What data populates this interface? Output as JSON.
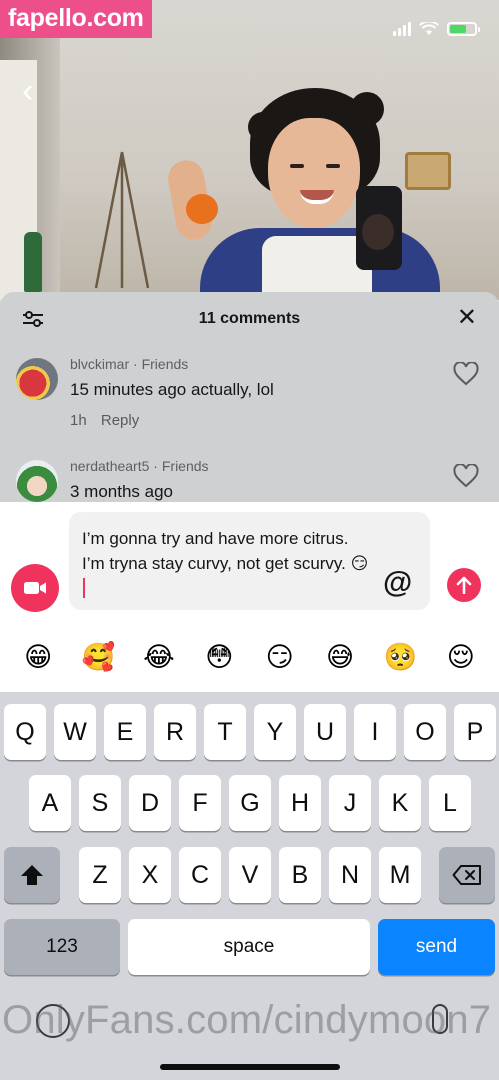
{
  "watermark": {
    "site": "fapello.com",
    "bottom": "OnlyFans.com/cindymoon7"
  },
  "comments_panel": {
    "title": "11 comments",
    "comments": [
      {
        "username": "blvckimar",
        "badge": "Friends",
        "text": "15 minutes ago actually, lol",
        "age": "1h",
        "reply_label": "Reply"
      },
      {
        "username": "nerdatheart5",
        "badge": "Friends",
        "text": "3 months ago"
      }
    ]
  },
  "composer": {
    "draft_text": "I’m gonna try and have more citrus. I’m tryna stay curvy, not get scurvy. 😏",
    "mention_symbol": "@",
    "emojis": [
      "😁",
      "🥰",
      "😂",
      "😳",
      "😏",
      "😅",
      "🥺",
      "😌"
    ]
  },
  "keyboard": {
    "row1": [
      "Q",
      "W",
      "E",
      "R",
      "T",
      "Y",
      "U",
      "I",
      "O",
      "P"
    ],
    "row2": [
      "A",
      "S",
      "D",
      "F",
      "G",
      "H",
      "J",
      "K",
      "L"
    ],
    "row3": [
      "Z",
      "X",
      "C",
      "V",
      "B",
      "N",
      "M"
    ],
    "numbers_label": "123",
    "space_label": "space",
    "send_label": "send"
  },
  "colors": {
    "accent": "#f0335c",
    "send_key": "#0a84ff",
    "watermark_bg": "#ec4f8a"
  }
}
